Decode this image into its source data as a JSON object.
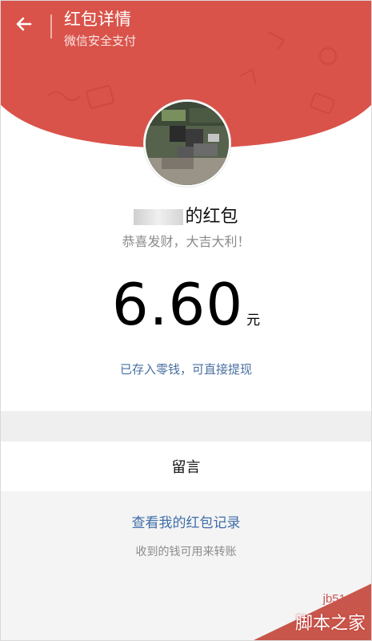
{
  "header": {
    "title": "红包详情",
    "subtitle": "微信安全支付",
    "back_icon": "arrow-left-icon",
    "color": "#d9534a"
  },
  "packet": {
    "sender_suffix": "的红包",
    "blessing": "恭喜发财，大吉大利！",
    "amount": "6.60",
    "currency": "元",
    "stored_note": "已存入零钱，可直接提现"
  },
  "message": {
    "label": "留言"
  },
  "records": {
    "link": "查看我的红包记录",
    "hint": "收到的钱可用来转账"
  },
  "watermark": {
    "site": "jb51.net",
    "text": "脚本之家"
  }
}
